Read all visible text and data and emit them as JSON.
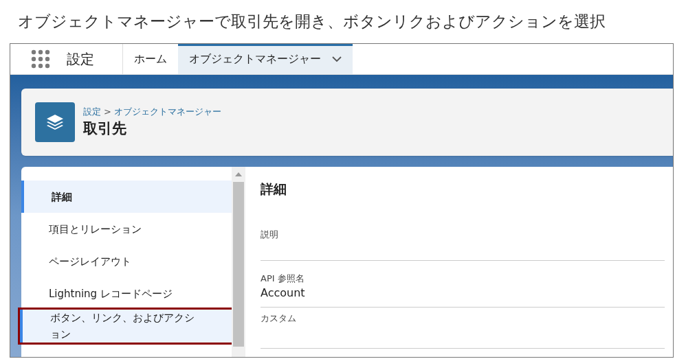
{
  "caption": "オブジェクトマネージャーで取引先を開き、ボタンリクおよびアクションを選択",
  "app": {
    "name": "設定"
  },
  "tabs": [
    {
      "label": "ホーム",
      "selected": false,
      "dropdown": false
    },
    {
      "label": "オブジェクトマネージャー",
      "selected": true,
      "dropdown": true
    }
  ],
  "breadcrumb": {
    "separator": ">",
    "links": [
      "設定",
      "オブジェクトマネージャー"
    ]
  },
  "page_title": "取引先",
  "sidebar": {
    "items": [
      {
        "label": "詳細",
        "selected": true,
        "outlined": false
      },
      {
        "label": "項目とリレーション",
        "selected": false,
        "outlined": false
      },
      {
        "label": "ページレイアウト",
        "selected": false,
        "outlined": false
      },
      {
        "label": "Lightning レコードページ",
        "selected": false,
        "outlined": false
      },
      {
        "label": "ボタン、リンク、およびアクション",
        "selected": true,
        "outlined": true
      }
    ]
  },
  "detail": {
    "title": "詳細",
    "fields": [
      {
        "label": "説明"
      },
      {
        "label": "API 参照名",
        "value": "Account"
      },
      {
        "label": "カスタム"
      }
    ]
  }
}
